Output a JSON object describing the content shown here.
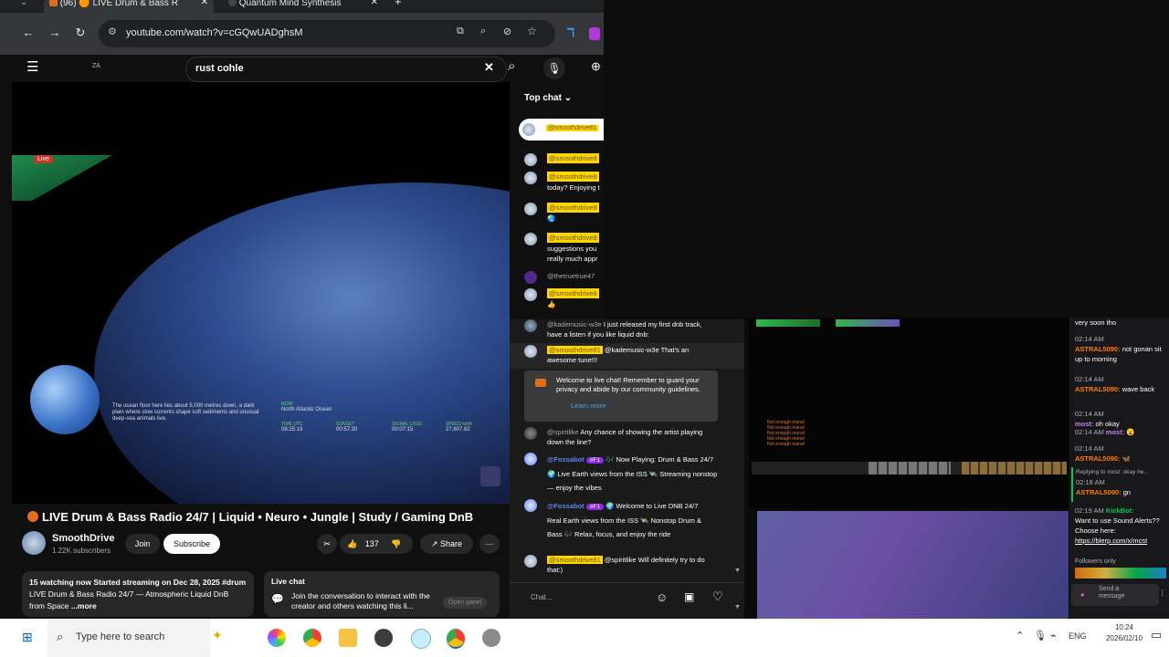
{
  "browser": {
    "tabs": [
      {
        "label": "(96) 🟠 LIVE Drum & Bass R"
      },
      {
        "label": "Quantum Mind Synthesis"
      }
    ],
    "url": "youtube.com/watch?v=cGQwUADghsM"
  },
  "youtube": {
    "search_value": "rust cohle",
    "logo_text": "ZA",
    "player": {
      "live_label": "Live",
      "caption": "The ocean floor here lies about 5,000 metres down, a dark plain where slow currents shape soft sediments and unusual deep-sea animals live.",
      "now_label": "NOW",
      "location": "North Atlantic Ocean",
      "time_utc_label": "TIME UTC",
      "time_utc": "08:25:19",
      "sunset_label": "SUNSET",
      "sunset": "00:57:30",
      "signal_label": "SIGNAL LOSS",
      "signal": "00:07:15",
      "speed_label": "SPEED km/h",
      "speed": "27,607.82"
    },
    "video_title": "LIVE Drum & Bass Radio 24/7 | Liquid • Neuro • Jungle | Study / Gaming DnB",
    "channel_name": "SmoothDrive",
    "subscribers": "1.22K subscribers",
    "join_label": "Join",
    "subscribe_label": "Subscribe",
    "like_count": "137",
    "share_label": "Share",
    "description": {
      "line1": "15 watching now  Started streaming on Dec 28, 2025  #drum",
      "line2": "LIVE Drum & Bass Radio 24/7 — Atmospheric Liquid DnB",
      "line3": "from Space",
      "more": "...more"
    },
    "livechat_box": {
      "title": "Live chat",
      "text": "Join the conversation to interact with the creator and others watching this li...",
      "open_panel": "Open panel"
    },
    "chat": {
      "header": "Top chat",
      "input_placeholder": "Chat...",
      "pinned_user": "@smoothdrive81",
      "messages": [
        {
          "user": "@smoothdrive8",
          "text": ""
        },
        {
          "user": "@smoothdrive8",
          "text": "today? Enjoying t"
        },
        {
          "user": "@smoothdrive8",
          "text": ""
        },
        {
          "user": "@smoothdrive8",
          "text": "suggestions you really much appr"
        },
        {
          "user": "@thetruetrue47",
          "text": ""
        },
        {
          "user": "@smoothdrive8",
          "text": "👍"
        },
        {
          "user": "@kademusic-w3e",
          "text": "I just released my first dnb track, have a listen if you like liquid dnb:"
        },
        {
          "user": "@smoothdrive81",
          "text": "@kademusic-w3e That's an awesome tune!!!"
        },
        {
          "user": "@spiritlike",
          "text": "Any chance of showing the artist playing down the line?"
        },
        {
          "user": "@Fossabot",
          "badge": "#F1",
          "text": "🎶 Now Playing: Drum & Bass 24/7 🌍 Live Earth views from the ISS 🛰️ Streaming nonstop — enjoy the vibes"
        },
        {
          "user": "@Fossabot",
          "badge": "#F1",
          "text": "🌍 Welcome to Live DNB 24/7 Real Earth views from the ISS 🛰️ Nonstop Drum & Bass 🎶 Relax, focus, and enjoy the ride"
        },
        {
          "user": "@smoothdrive81",
          "text": "@spiritlike Will definitely try to do that:)"
        }
      ],
      "welcome_text": "Welcome to live chat! Remember to guard your privacy and abide by our community guidelines.",
      "learn_more": "Learn more"
    }
  },
  "twitch": {
    "top_text": "very soon tho",
    "messages": [
      {
        "time": "02:14 AM",
        "user": "ASTRAL5090:",
        "text": "not gonan sit up to morning"
      },
      {
        "time": "02:14 AM",
        "user": "ASTRAL5090:",
        "text": "wave back"
      },
      {
        "time": "02:14 AM",
        "user": "most:",
        "text": "oh okay"
      },
      {
        "time": "02:14 AM",
        "user": "most:",
        "text": "😮"
      },
      {
        "time": "02:14 AM",
        "user": "ASTRAL5090:",
        "text": "🦋"
      }
    ],
    "reply_label": "Replying to mcst: okay he..",
    "reply_time": "02:18 AM",
    "reply_user": "ASTRAL5090:",
    "reply_text": "gn",
    "kick_time": "02:19 AM",
    "kick_user": "KickBot:",
    "kick_text": "Want to use Sound Alerts?? Choose here:",
    "kick_link": "https://blerp.com/x/mcst",
    "followers_only": "Followers only",
    "send_label": "Send a message"
  },
  "game": {
    "messages": [
      "Not enough mana!",
      "Not enough mana!",
      "Not enough mana!",
      "Not enough mana!",
      "Not enough mana!"
    ]
  },
  "taskbar": {
    "search_placeholder": "Type here to search",
    "lang": "ENG",
    "time": "10:24",
    "date": "2026/02/10"
  }
}
